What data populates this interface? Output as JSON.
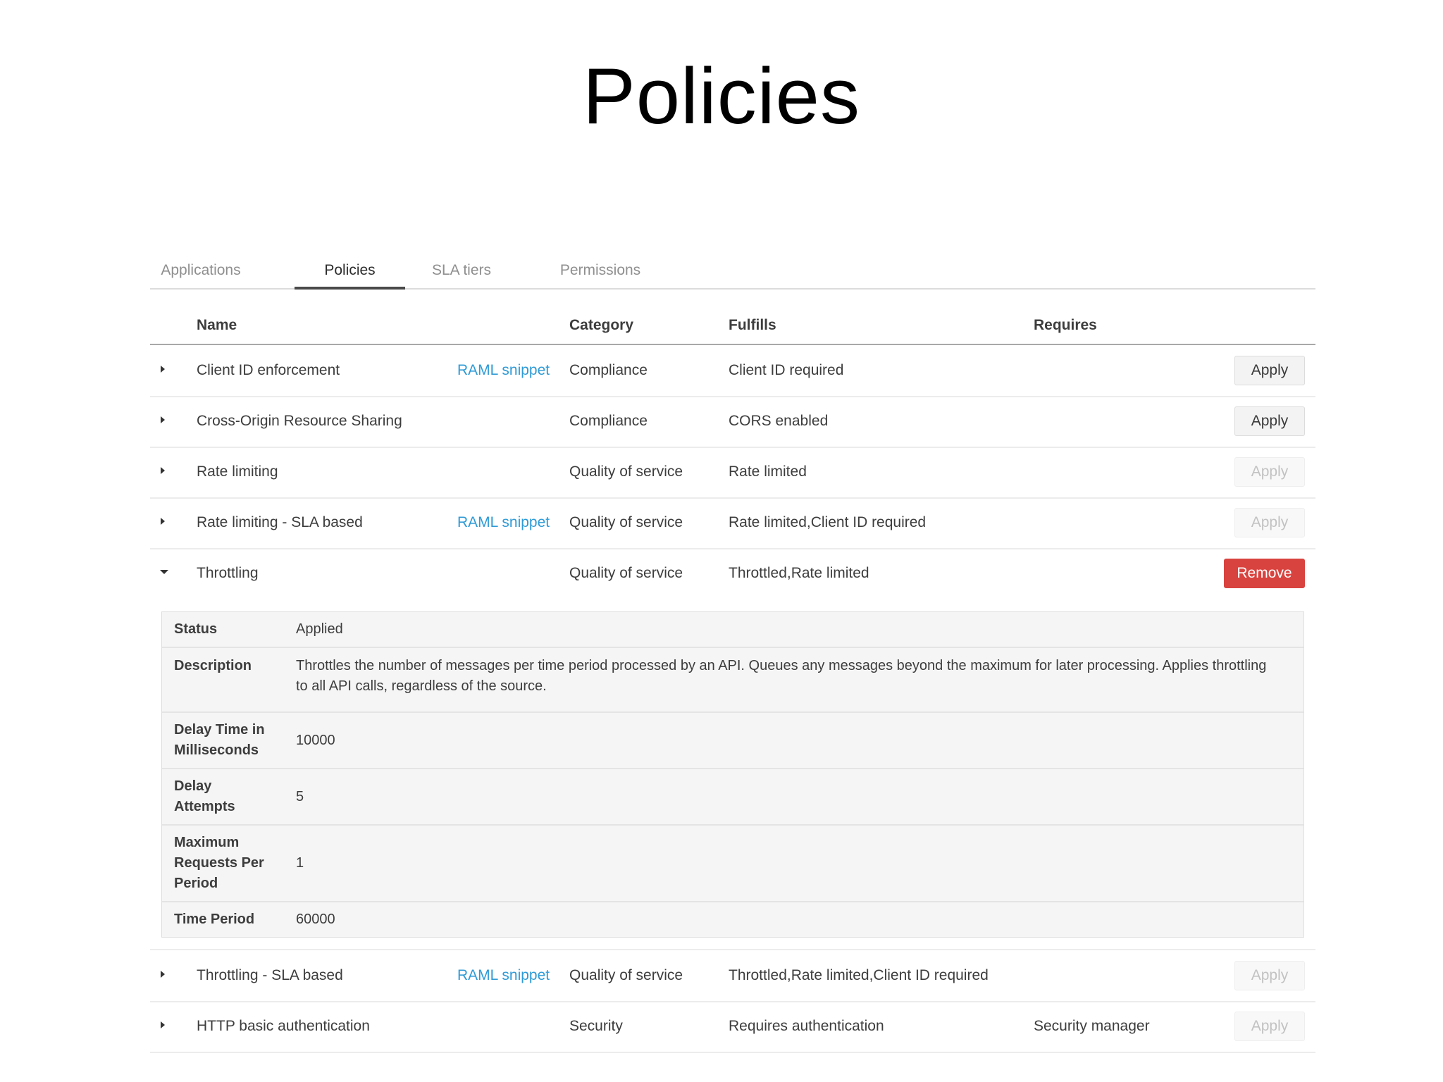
{
  "page": {
    "title": "Policies"
  },
  "tabs": [
    {
      "label": "Applications",
      "active": false
    },
    {
      "label": "Policies",
      "active": true
    },
    {
      "label": "SLA tiers",
      "active": false
    },
    {
      "label": "Permissions",
      "active": false
    }
  ],
  "table": {
    "headers": {
      "name": "Name",
      "category": "Category",
      "fulfills": "Fulfills",
      "requires": "Requires"
    },
    "rows": [
      {
        "name": "Client ID enforcement",
        "snippet": "RAML snippet",
        "category": "Compliance",
        "fulfills": "Client ID required",
        "requires": "",
        "action": "Apply",
        "action_state": "enabled",
        "expanded": false
      },
      {
        "name": "Cross-Origin Resource Sharing",
        "snippet": "",
        "category": "Compliance",
        "fulfills": "CORS enabled",
        "requires": "",
        "action": "Apply",
        "action_state": "enabled",
        "expanded": false
      },
      {
        "name": "Rate limiting",
        "snippet": "",
        "category": "Quality of service",
        "fulfills": "Rate limited",
        "requires": "",
        "action": "Apply",
        "action_state": "disabled",
        "expanded": false
      },
      {
        "name": "Rate limiting - SLA based",
        "snippet": "RAML snippet",
        "category": "Quality of service",
        "fulfills": "Rate limited,Client ID required",
        "requires": "",
        "action": "Apply",
        "action_state": "disabled",
        "expanded": false
      },
      {
        "name": "Throttling",
        "snippet": "",
        "category": "Quality of service",
        "fulfills": "Throttled,Rate limited",
        "requires": "",
        "action": "Remove",
        "action_state": "danger",
        "expanded": true
      },
      {
        "name": "Throttling - SLA based",
        "snippet": "RAML snippet",
        "category": "Quality of service",
        "fulfills": "Throttled,Rate limited,Client ID required",
        "requires": "",
        "action": "Apply",
        "action_state": "disabled",
        "expanded": false
      },
      {
        "name": "HTTP basic authentication",
        "snippet": "",
        "category": "Security",
        "fulfills": "Requires authentication",
        "requires": "Security manager",
        "action": "Apply",
        "action_state": "disabled",
        "expanded": false
      }
    ]
  },
  "details": {
    "status": {
      "label": "Status",
      "value": "Applied"
    },
    "description": {
      "label": "Description",
      "value": "Throttles the number of messages per time period processed by an API. Queues any messages beyond the maximum for later processing. Applies throttling to all API calls, regardless of the source."
    },
    "delay_time": {
      "label": "Delay Time in Milliseconds",
      "value": "10000"
    },
    "delay_attempts": {
      "label": "Delay Attempts",
      "value": "5"
    },
    "max_requests": {
      "label": "Maximum Requests Per Period",
      "value": "1"
    },
    "time_period": {
      "label": "Time Period",
      "value": "60000"
    }
  },
  "colors": {
    "link": "#2f9bd6",
    "danger": "#d9433f",
    "details_bg": "#f5f5f5"
  },
  "icons": {
    "collapsed": "caret-right-icon",
    "expanded": "caret-down-icon"
  }
}
